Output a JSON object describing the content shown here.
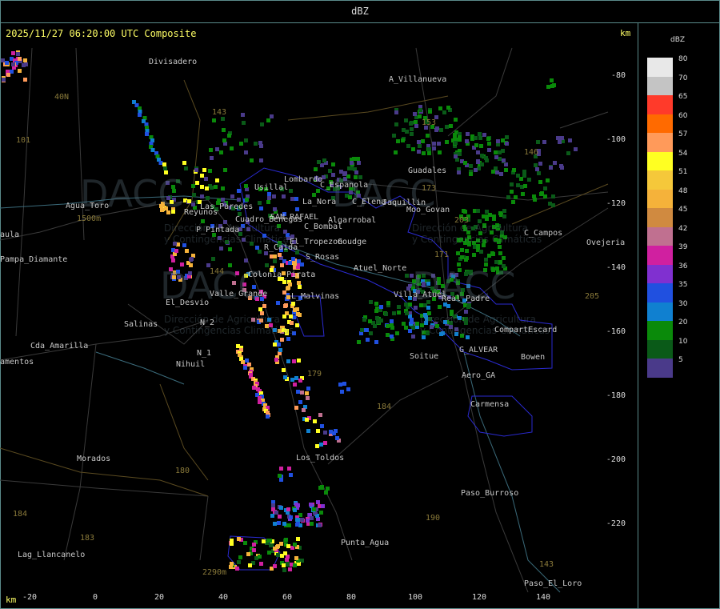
{
  "header": {
    "title": "dBZ"
  },
  "timestamp": "2025/11/27 06:20:00 UTC Composite",
  "axis_unit": "km",
  "y_axis_ticks": [
    "-80",
    "-100",
    "-120",
    "-140",
    "-160",
    "-180",
    "-200",
    "-220"
  ],
  "x_axis_ticks": [
    "-20",
    "0",
    "20",
    "40",
    "60",
    "80",
    "100",
    "120",
    "140"
  ],
  "legend": {
    "title": "dBZ",
    "levels": [
      {
        "label": "80",
        "color": "#e8e8e8"
      },
      {
        "label": "70",
        "color": "#c4c4c4"
      },
      {
        "label": "65",
        "color": "#ff3a2a"
      },
      {
        "label": "60",
        "color": "#ff6a00"
      },
      {
        "label": "57",
        "color": "#ff9a5a"
      },
      {
        "label": "54",
        "color": "#ffff22"
      },
      {
        "label": "51",
        "color": "#f5c83a"
      },
      {
        "label": "48",
        "color": "#f5b23a"
      },
      {
        "label": "45",
        "color": "#d08a40"
      },
      {
        "label": "42",
        "color": "#c07090"
      },
      {
        "label": "39",
        "color": "#d020a0"
      },
      {
        "label": "36",
        "color": "#8030d0"
      },
      {
        "label": "35",
        "color": "#2050e0"
      },
      {
        "label": "30",
        "color": "#1080d0"
      },
      {
        "label": "20",
        "color": "#0a8a0a"
      },
      {
        "label": "10",
        "color": "#0a5a18"
      },
      {
        "label": "5",
        "color": "#4a3a8a"
      }
    ]
  },
  "places": [
    "Divisadero",
    "A_Villanueva",
    "40N",
    "101",
    "Agua_Toro",
    "aula",
    "Pampa_Diamante",
    "Reyunos",
    "Usillal",
    "Lombardo",
    "C_Espanola",
    "La_Nora",
    "C_Elena",
    "SAN RAFAEL",
    "C_Bombal",
    "Algarrobal",
    "Las_Paredes",
    "P_Pintada",
    "El_Tropezon",
    "Goudge",
    "R_Caida",
    "S_Rosas",
    "Atuel_Norte",
    "Cuadro_Benegas",
    "Guadales",
    "Jaquillin",
    "Moo_Govan",
    "C_Campos",
    "Ovejeria",
    "Villa_Atuel",
    "Real_Padre",
    "L_Malvinas",
    "Valle_Grande",
    "El_Desvio",
    "Salinas",
    "N_2",
    "N_1",
    "Nihuil",
    "Cda_Amarilla",
    "amentos",
    "Soitue",
    "G_ALVEAR",
    "Bowen",
    "CompartEscard",
    "Aero_GA",
    "Carmensa",
    "Morados",
    "Los_Toldos",
    "Paso_Burroso",
    "Punta_Agua",
    "Lag_Llancanelo",
    "Paso_El_Loro",
    "2290m",
    "1500m",
    "Colonia_Pirata",
    "L_Malvinas"
  ],
  "routes": [
    "143",
    "153",
    "146",
    "173",
    "203",
    "171",
    "205",
    "144",
    "179",
    "184",
    "180",
    "190",
    "183",
    "184",
    "143"
  ],
  "watermark": {
    "brand": "DACC",
    "line1": "Dirección de Agricultura",
    "line2": "y Contingencias Climáticas"
  }
}
